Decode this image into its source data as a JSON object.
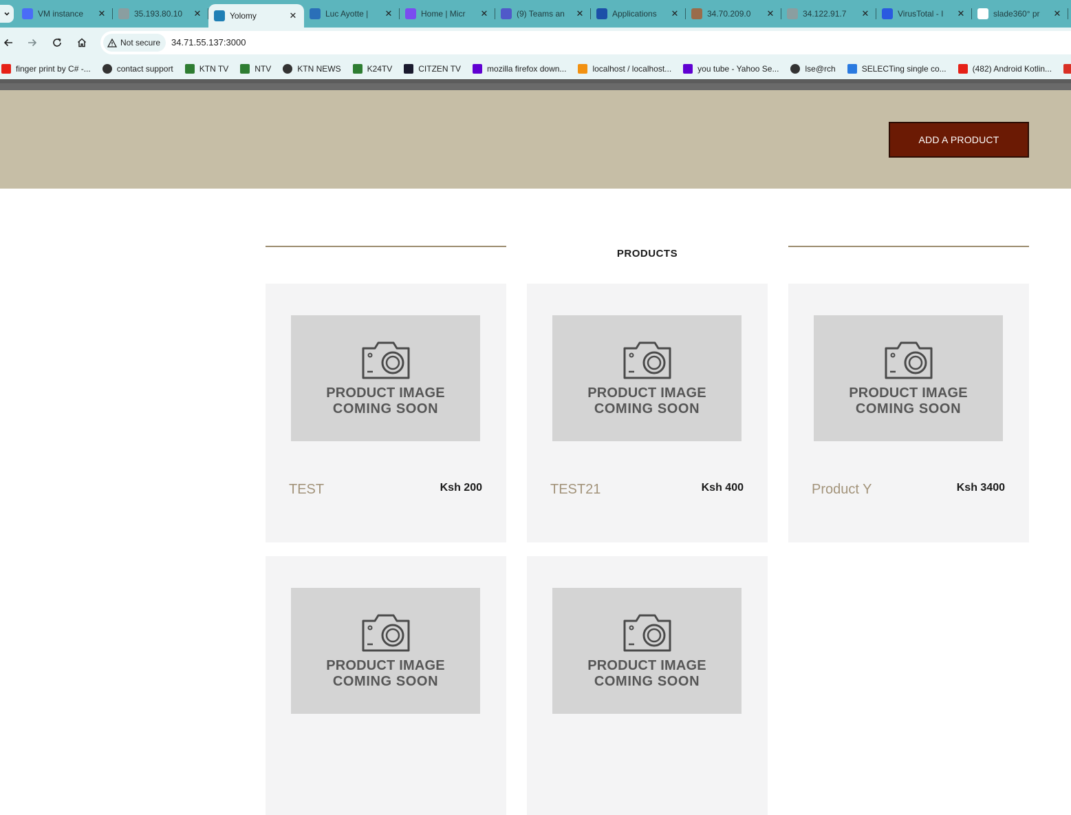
{
  "browser": {
    "tabs": [
      {
        "title": "VM instance",
        "favicon": "vm-icon",
        "color": "#4a6cf7",
        "active": false
      },
      {
        "title": "35.193.80.10",
        "favicon": "globe-icon",
        "color": "#8a9ea0",
        "active": false
      },
      {
        "title": "Yolomy",
        "favicon": "react-icon",
        "color": "#1f7fb5",
        "active": true
      },
      {
        "title": "Luc Ayotte |",
        "favicon": "cloud-icon",
        "color": "#2a6fb8",
        "active": false
      },
      {
        "title": "Home | Micr",
        "favicon": "copilot-icon",
        "color": "#7a4cf0",
        "active": false
      },
      {
        "title": "(9) Teams an",
        "favicon": "teams-icon",
        "color": "#5059c9",
        "active": false
      },
      {
        "title": "Applications",
        "favicon": "azure-icon",
        "color": "#1c4fa8",
        "active": false
      },
      {
        "title": "34.70.209.0",
        "favicon": "jenkins-icon",
        "color": "#9a6c4a",
        "active": false
      },
      {
        "title": "34.122.91.7",
        "favicon": "globe-icon",
        "color": "#8a9ea0",
        "active": false
      },
      {
        "title": "VirusTotal - I",
        "favicon": "virustotal-icon",
        "color": "#2a5ae0",
        "active": false
      },
      {
        "title": "slade360° pr",
        "favicon": "google-icon",
        "color": "#ffffff",
        "active": false
      }
    ],
    "toolbar": {
      "security_label": "Not secure",
      "url": "34.71.55.137:3000"
    },
    "bookmarks": [
      {
        "label": "finger print by C# -...",
        "icon": "youtube-icon",
        "color": "#e62117"
      },
      {
        "label": "contact support",
        "icon": "globe-icon",
        "color": "#333333"
      },
      {
        "label": "KTN TV",
        "icon": "ktn-icon",
        "color": "#2e7d32"
      },
      {
        "label": "NTV",
        "icon": "ntv-icon",
        "color": "#2e7d32"
      },
      {
        "label": "KTN NEWS",
        "icon": "globe-icon",
        "color": "#333333"
      },
      {
        "label": "K24TV",
        "icon": "k24-icon",
        "color": "#2e7d32"
      },
      {
        "label": "CITZEN TV",
        "icon": "citizen-icon",
        "color": "#1a1a2e"
      },
      {
        "label": "mozilla firefox down...",
        "icon": "yahoo-icon",
        "color": "#6001d2"
      },
      {
        "label": "localhost / localhost...",
        "icon": "phpmyadmin-icon",
        "color": "#f29111"
      },
      {
        "label": "you tube - Yahoo Se...",
        "icon": "yahoo-icon",
        "color": "#6001d2"
      },
      {
        "label": "lse@rch",
        "icon": "globe-icon",
        "color": "#333333"
      },
      {
        "label": "SELECTing single co...",
        "icon": "shield-icon",
        "color": "#2a7ae0"
      },
      {
        "label": "(482) Android Kotlin...",
        "icon": "youtube-icon",
        "color": "#e62117"
      },
      {
        "label": "",
        "icon": "gmail-icon",
        "color": "#d93025"
      }
    ]
  },
  "page": {
    "add_button_label": "ADD A PRODUCT",
    "section_title": "PRODUCTS",
    "placeholder_line1": "PRODUCT IMAGE",
    "placeholder_line2": "COMING SOON",
    "products": [
      {
        "name": "TEST",
        "price": "Ksh 200"
      },
      {
        "name": "TEST21",
        "price": "Ksh 400"
      },
      {
        "name": "Product Y",
        "price": "Ksh 3400"
      },
      {
        "name": "",
        "price": ""
      },
      {
        "name": "",
        "price": ""
      }
    ],
    "colors": {
      "hero": "#c6bea6",
      "button": "#6b1a04",
      "product_name": "#a2937a"
    }
  }
}
